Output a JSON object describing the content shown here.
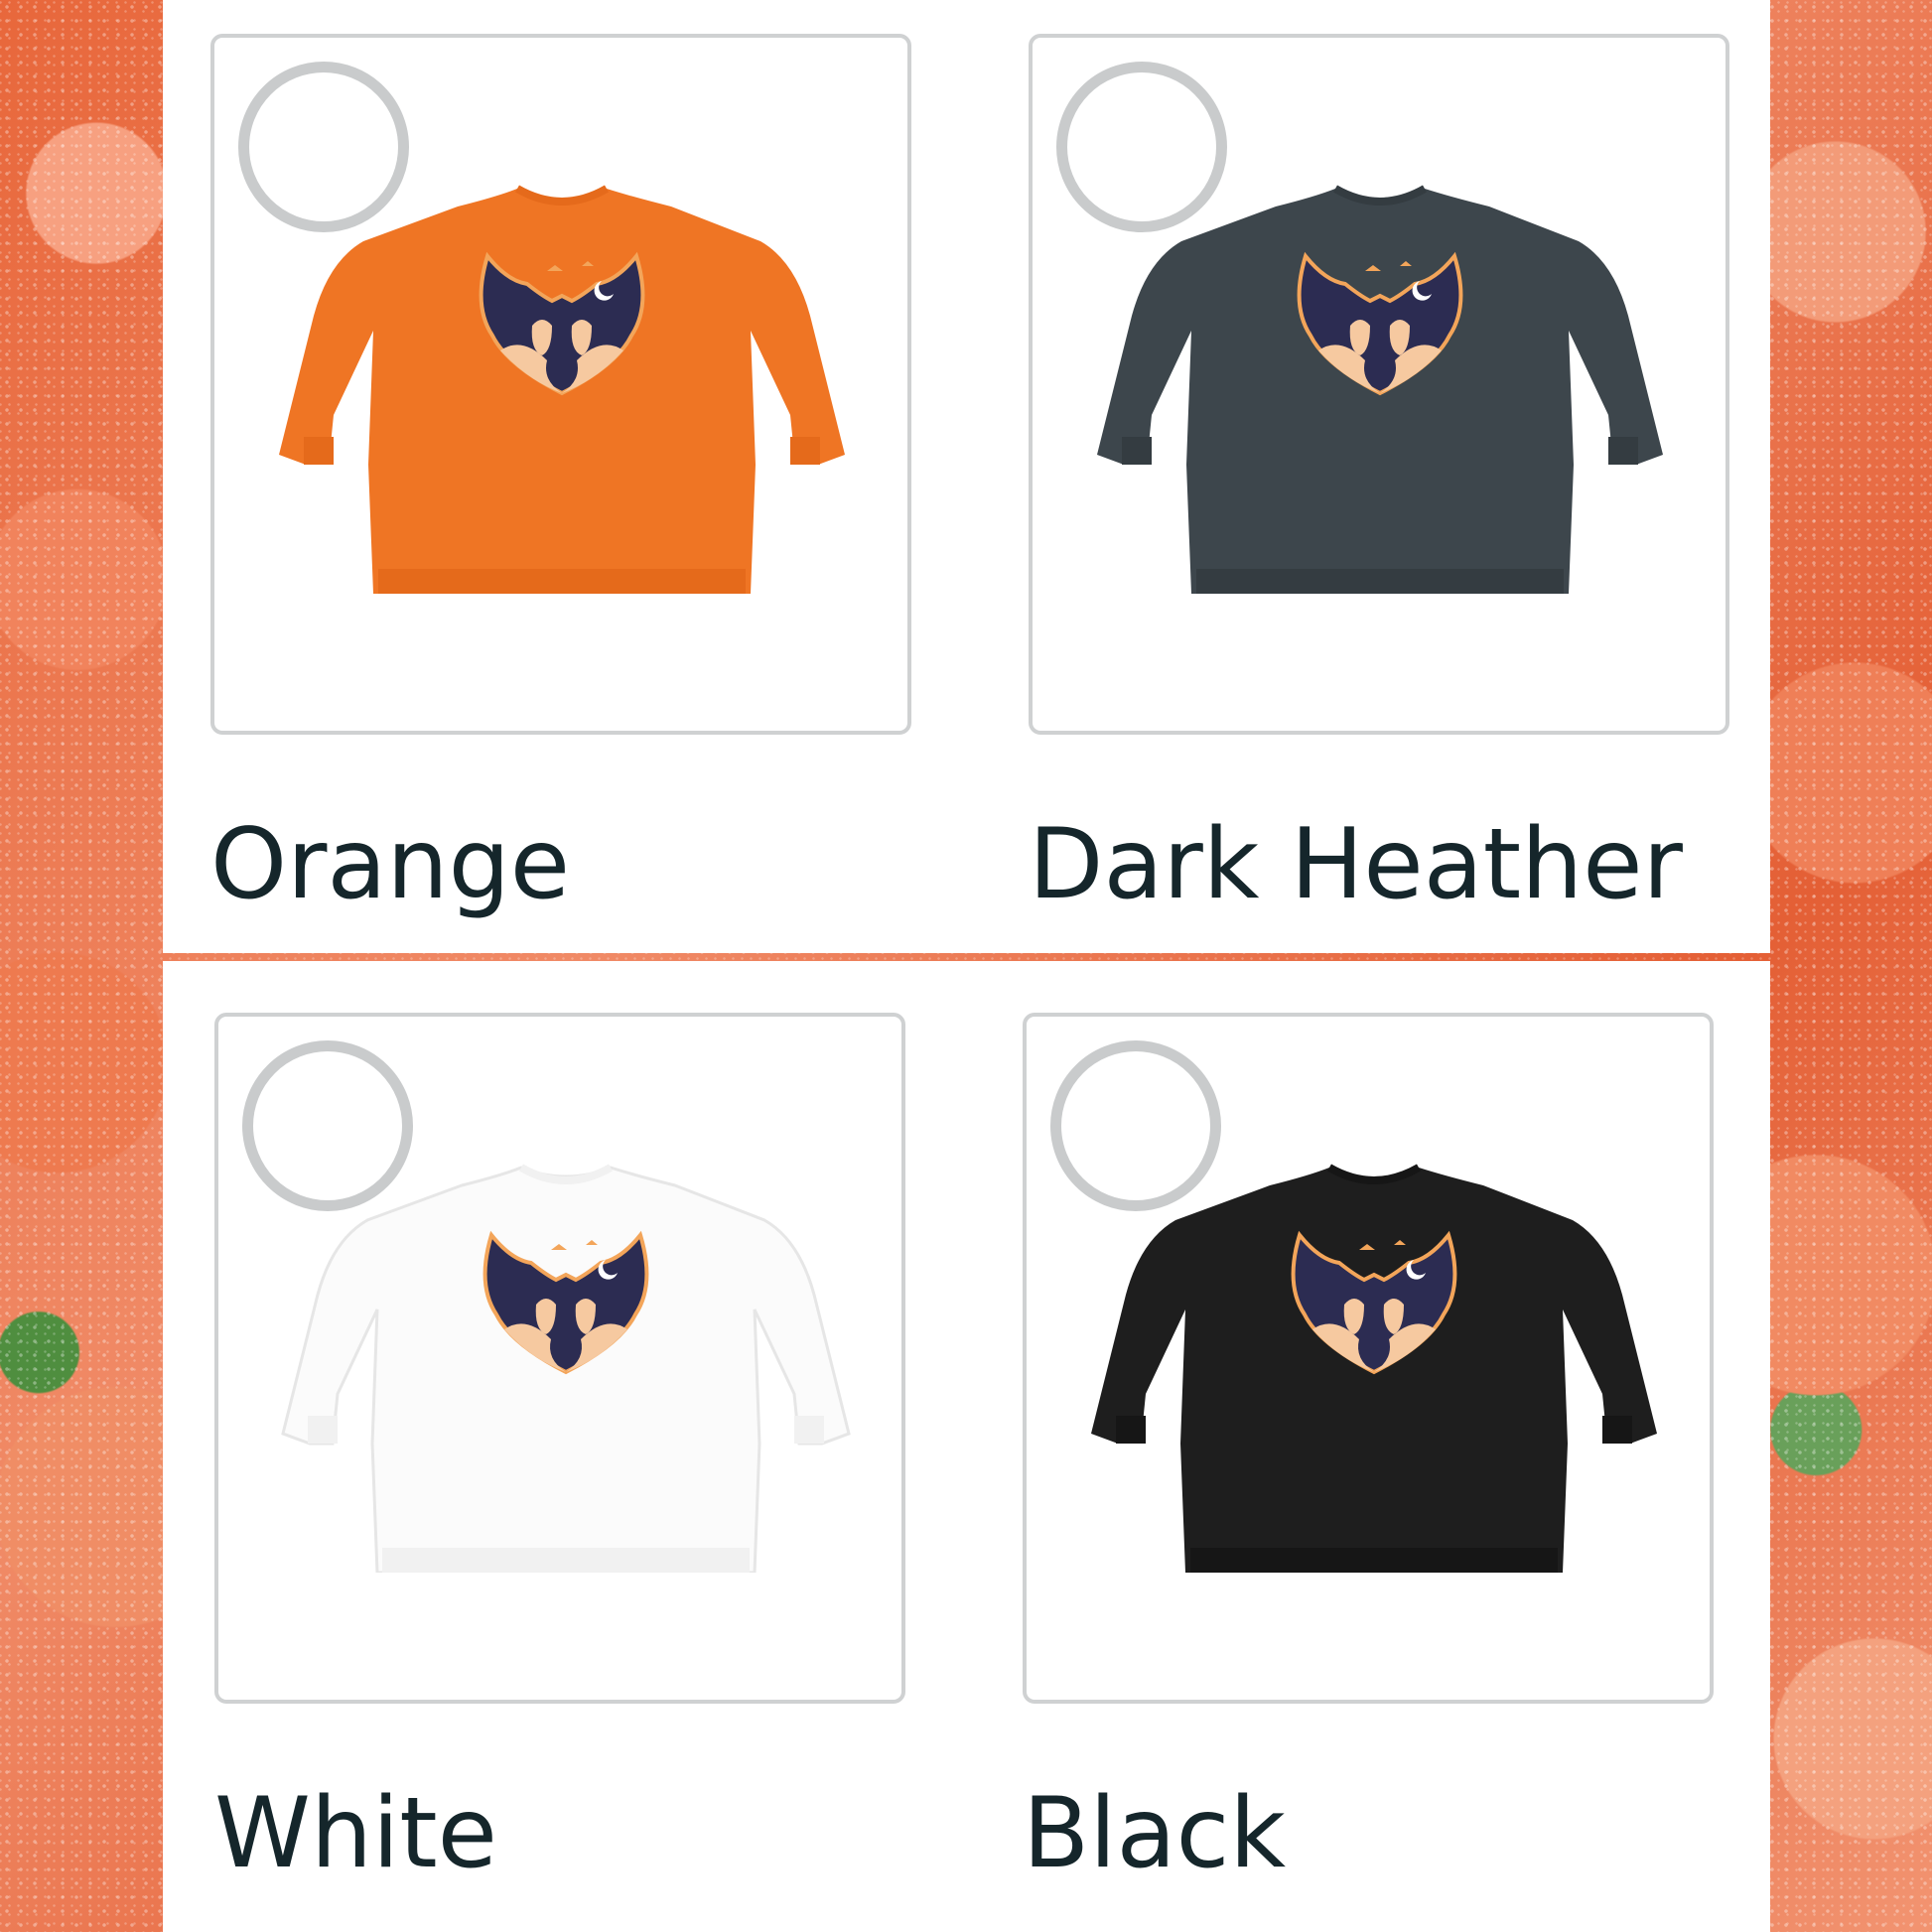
{
  "variants": [
    {
      "label": "Orange",
      "color": "#ef7524",
      "cuff": "#e56a1b"
    },
    {
      "label": "Dark Heather",
      "color": "#3d464c",
      "cuff": "#343c41"
    },
    {
      "label": "White",
      "color": "#fbfbfb",
      "cuff": "#f1f1f1"
    },
    {
      "label": "Black",
      "color": "#1e1e1e",
      "cuff": "#161616"
    }
  ],
  "design": {
    "icon": "bat-halloween-graphic",
    "wing_color": "#2c2c52",
    "accent_color": "#f3a55a",
    "belly_color": "#f6c9a0"
  }
}
